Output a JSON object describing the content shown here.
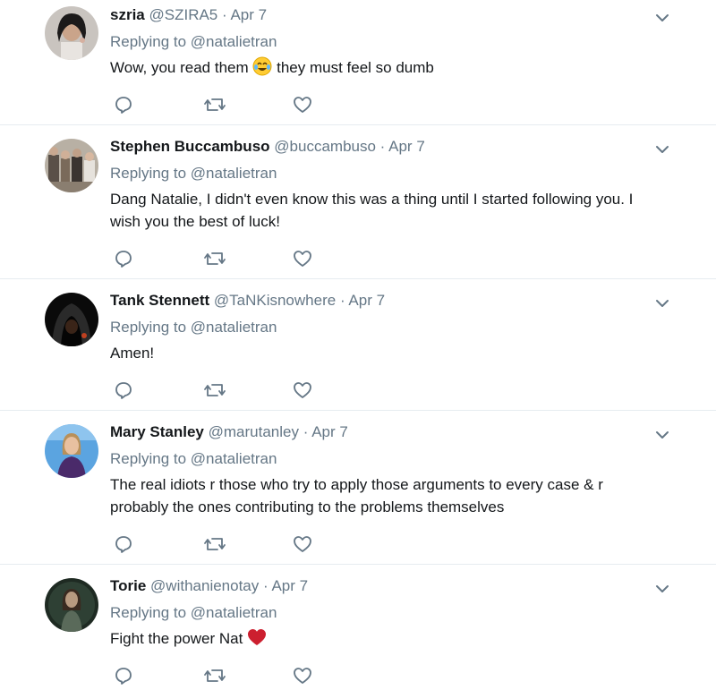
{
  "tweets": [
    {
      "name": "szria",
      "handle": "@SZIRA5",
      "dot": "·",
      "time": "Apr 7",
      "reply_prefix": "Replying to",
      "reply_to": "@natalietran",
      "text_before": "Wow, you read them",
      "text_after": "they must feel so dumb",
      "emoji": "face-with-tears-of-joy"
    },
    {
      "name": "Stephen Buccambuso",
      "handle": "@buccambuso",
      "dot": "·",
      "time": "Apr 7",
      "reply_prefix": "Replying to",
      "reply_to": "@natalietran",
      "text_line1": "Dang Natalie, I didn't even know this was a thing until I started following you. I",
      "text_line2": "wish you the best of luck!"
    },
    {
      "name": "Tank Stennett",
      "handle": "@TaNKisnowhere",
      "dot": "·",
      "time": "Apr 7",
      "reply_prefix": "Replying to",
      "reply_to": "@natalietran",
      "text": "Amen!"
    },
    {
      "name": "Mary Stanley",
      "handle": "@marutanley",
      "dot": "·",
      "time": "Apr 7",
      "reply_prefix": "Replying to",
      "reply_to": "@natalietran",
      "text_line1": "The real idiots r those who try to apply those arguments to every case & r",
      "text_line2": "probably the ones contributing to the problems themselves"
    },
    {
      "name": "Torie",
      "handle": "@withanienotay",
      "dot": "·",
      "time": "Apr 7",
      "reply_prefix": "Replying to",
      "reply_to": "@natalietran",
      "text": "Fight the power Nat",
      "emoji": "red-heart"
    }
  ],
  "colors": {
    "text": "#14171a",
    "muted": "#657786",
    "divider": "#e6ecf0"
  }
}
